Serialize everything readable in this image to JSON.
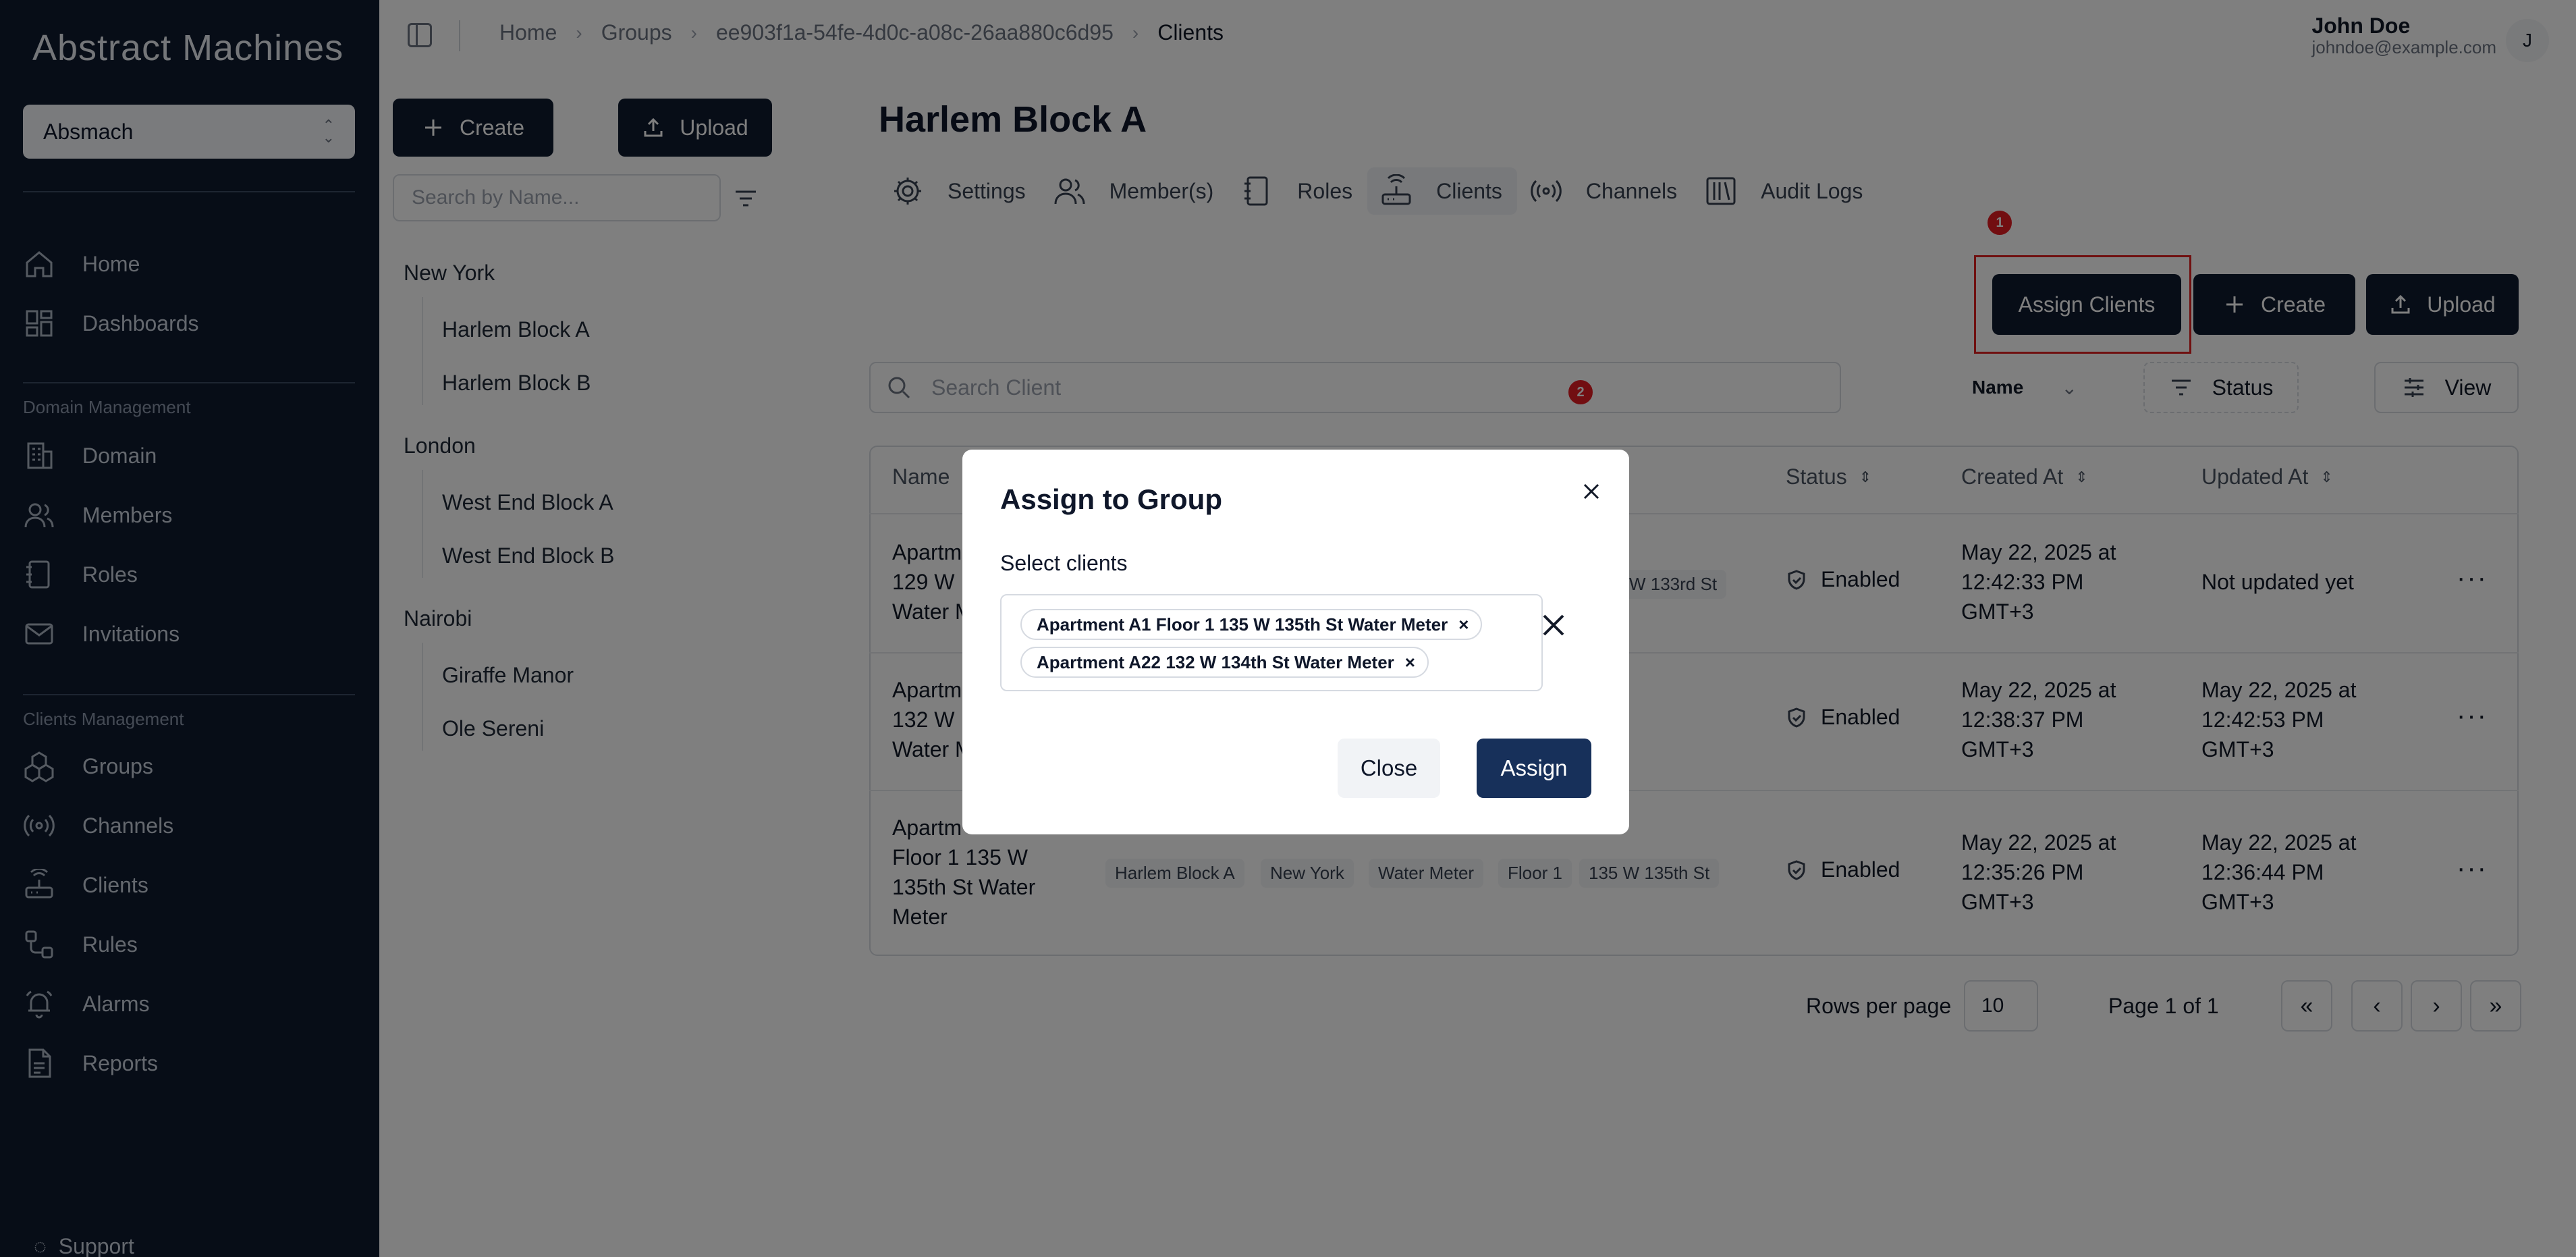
{
  "app": {
    "logo": "Abstract Machines"
  },
  "org": {
    "selected": "Absmach"
  },
  "sidebar": {
    "top_items": [
      {
        "label": "Home",
        "icon": "home-icon"
      },
      {
        "label": "Dashboards",
        "icon": "dashboard-icon"
      }
    ],
    "domain_section": "Domain Management",
    "domain_items": [
      {
        "label": "Domain"
      },
      {
        "label": "Members"
      },
      {
        "label": "Roles"
      },
      {
        "label": "Invitations"
      }
    ],
    "clients_section": "Clients Management",
    "clients_items": [
      {
        "label": "Groups"
      },
      {
        "label": "Channels"
      },
      {
        "label": "Clients"
      },
      {
        "label": "Rules"
      },
      {
        "label": "Alarms"
      },
      {
        "label": "Reports"
      }
    ],
    "support": "Support"
  },
  "breadcrumb": [
    "Home",
    "Groups",
    "ee903f1a-54fe-4d0c-a08c-26aa880c6d95",
    "Clients"
  ],
  "user": {
    "name": "John Doe",
    "email": "johndoe@example.com",
    "initial": "J"
  },
  "groups_panel": {
    "create_label": "Create",
    "upload_label": "Upload",
    "search_placeholder": "Search by Name...",
    "tree": [
      {
        "name": "New York",
        "children": [
          "Harlem Block A",
          "Harlem Block B"
        ]
      },
      {
        "name": "London",
        "children": [
          "West End Block A",
          "West End Block B"
        ]
      },
      {
        "name": "Nairobi",
        "children": [
          "Giraffe Manor",
          "Ole Sereni"
        ]
      }
    ]
  },
  "main": {
    "title": "Harlem Block A",
    "tabs": [
      "Settings",
      "Member(s)",
      "Roles",
      "Clients",
      "Channels",
      "Audit Logs"
    ],
    "actions": {
      "assign": "Assign Clients",
      "create": "Create",
      "upload": "Upload"
    },
    "annotations": [
      "1",
      "2"
    ],
    "search_placeholder": "Search Client",
    "name_select": "Name",
    "status_filter": "Status",
    "view": "View"
  },
  "table": {
    "headers": [
      "Name",
      "Status",
      "Created At",
      "Updated At"
    ],
    "rows": [
      {
        "name": [
          "Apartm",
          "129 W",
          "Water M"
        ],
        "tag_tail": "W 133rd St",
        "status": "Enabled",
        "created": [
          "May 22, 2025 at",
          "12:42:33 PM",
          "GMT+3"
        ],
        "updated": [
          "Not updated yet"
        ]
      },
      {
        "name": [
          "Apartm",
          "132 W",
          "Water M"
        ],
        "status": "Enabled",
        "created": [
          "May 22, 2025 at",
          "12:38:37 PM",
          "GMT+3"
        ],
        "updated": [
          "May 22, 2025 at",
          "12:42:53 PM",
          "GMT+3"
        ]
      },
      {
        "name": [
          "Apartm",
          "Floor 1 135 W",
          "135th St Water",
          "Meter"
        ],
        "tags": [
          "Harlem Block A",
          "New York",
          "Water Meter",
          "Floor 1",
          "135 W 135th St"
        ],
        "status": "Enabled",
        "created": [
          "May 22, 2025 at",
          "12:35:26 PM",
          "GMT+3"
        ],
        "updated": [
          "May 22, 2025 at",
          "12:36:44 PM",
          "GMT+3"
        ]
      }
    ]
  },
  "pagination": {
    "rows_label": "Rows per page",
    "rows_value": "10",
    "page_label": "Page 1 of 1",
    "first": "«",
    "prev": "‹",
    "next": "›",
    "last": "»"
  },
  "dialog": {
    "title": "Assign to Group",
    "label": "Select clients",
    "chips": [
      "Apartment A1 Floor 1 135 W 135th St Water Meter",
      "Apartment A22 132 W 134th St Water Meter"
    ],
    "close": "Close",
    "assign": "Assign"
  }
}
